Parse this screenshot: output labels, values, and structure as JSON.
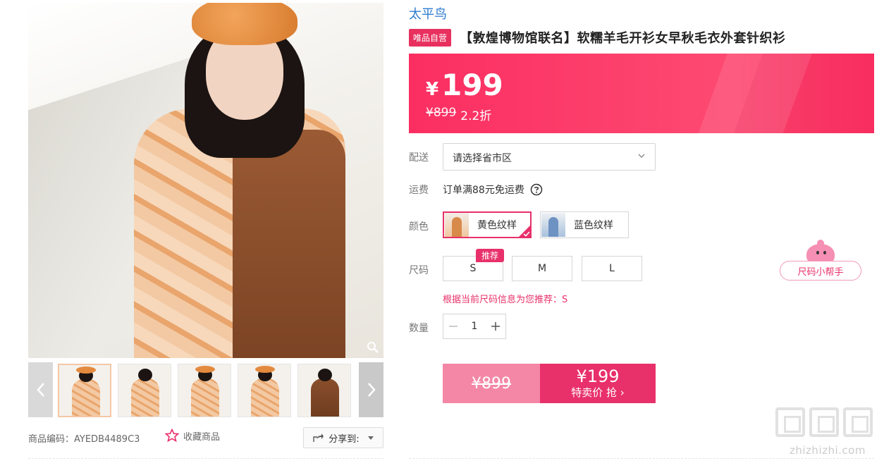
{
  "gallery": {
    "thumb_count": 5,
    "code_label": "商品编码：",
    "code_value": "AYEDB4489C3",
    "favorite_label": "收藏商品",
    "share_label": "分享到:"
  },
  "product": {
    "brand": "太平鸟",
    "self_tag": "唯品自营",
    "title": "【敦煌博物馆联名】软糯羊毛开衫女早秋毛衣外套针织衫"
  },
  "price": {
    "currency": "¥",
    "current": "199",
    "original": "¥899",
    "discount": "2.2折"
  },
  "delivery": {
    "label": "配送",
    "placeholder": "请选择省市区"
  },
  "shipping": {
    "label": "运费",
    "text": "订单满88元免运费"
  },
  "colors": {
    "label": "颜色",
    "options": [
      {
        "name": "黄色纹样",
        "selected": true
      },
      {
        "name": "蓝色纹样",
        "selected": false
      }
    ]
  },
  "sizes": {
    "label": "尺码",
    "recommend_tag": "推荐",
    "options": [
      "S",
      "M",
      "L"
    ],
    "hint": "根据当前尺码信息为您推荐：S",
    "helper": "尺码小帮手"
  },
  "quantity": {
    "label": "数量",
    "value": "1"
  },
  "buy": {
    "old_price": "¥899",
    "new_price": "¥199",
    "action": "特卖价 抢 ›"
  },
  "watermark": {
    "text": "zhizhizhi.com"
  },
  "colors_theme": {
    "accent": "#e8306a",
    "price_bg": "#fb2e62",
    "brand_link": "#2e7bcf"
  }
}
